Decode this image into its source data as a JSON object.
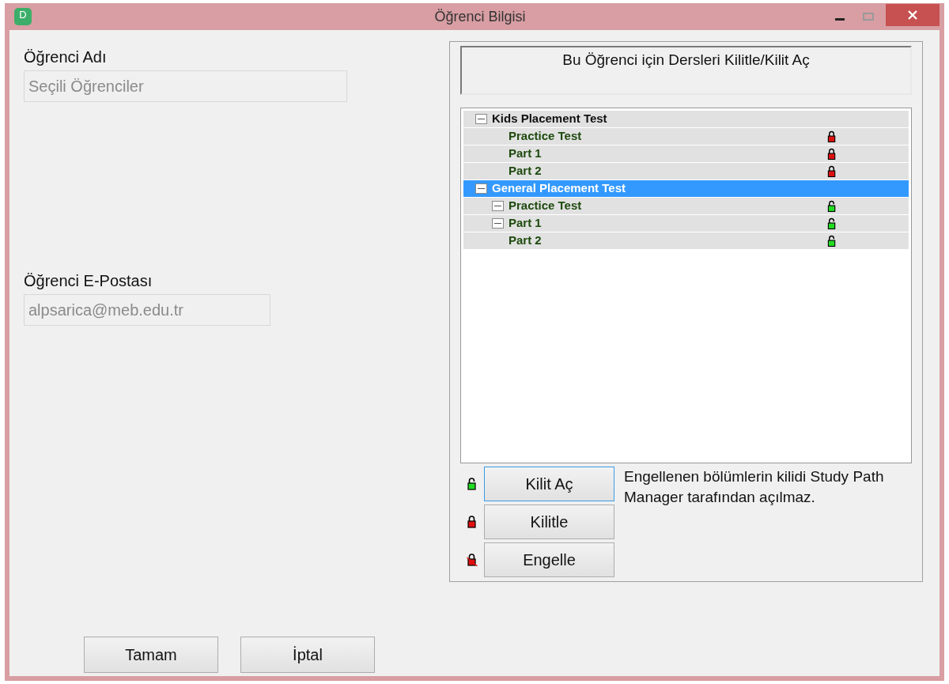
{
  "window": {
    "title": "Öğrenci Bilgisi",
    "app_icon_letter": "D"
  },
  "student_name": {
    "label": "Öğrenci Adı",
    "value": "Seçili Öğrenciler"
  },
  "student_email": {
    "label": "Öğrenci E-Postası",
    "value": "alpsarica@meb.edu.tr"
  },
  "lessons_panel": {
    "title": "Bu Öğrenci için Dersleri Kilitle/Kilit Aç",
    "tree": [
      {
        "label": "Kids Placement Test",
        "selected": false,
        "expanded": true,
        "children": [
          {
            "label": "Practice Test",
            "selected": false,
            "expanded": false,
            "locked": true
          },
          {
            "label": "Part 1",
            "selected": false,
            "expanded": false,
            "locked": true
          },
          {
            "label": "Part 2",
            "selected": false,
            "expanded": false,
            "locked": true
          }
        ]
      },
      {
        "label": "General Placement Test",
        "selected": true,
        "expanded": true,
        "children": [
          {
            "label": "Practice Test",
            "selected": false,
            "expanded": true,
            "locked": false
          },
          {
            "label": "Part 1",
            "selected": false,
            "expanded": true,
            "locked": false
          },
          {
            "label": "Part 2",
            "selected": false,
            "expanded": false,
            "locked": false
          }
        ]
      }
    ],
    "actions": [
      {
        "label": "Kilit Aç",
        "kind": "unlock",
        "focused": true
      },
      {
        "label": "Kilitle",
        "kind": "lock",
        "focused": false
      },
      {
        "label": "Engelle",
        "kind": "block",
        "focused": false
      }
    ],
    "note": "Engellenen bölümlerin kilidi Study Path Manager tarafından açılmaz."
  },
  "buttons": [
    "Tamam",
    "İptal"
  ]
}
